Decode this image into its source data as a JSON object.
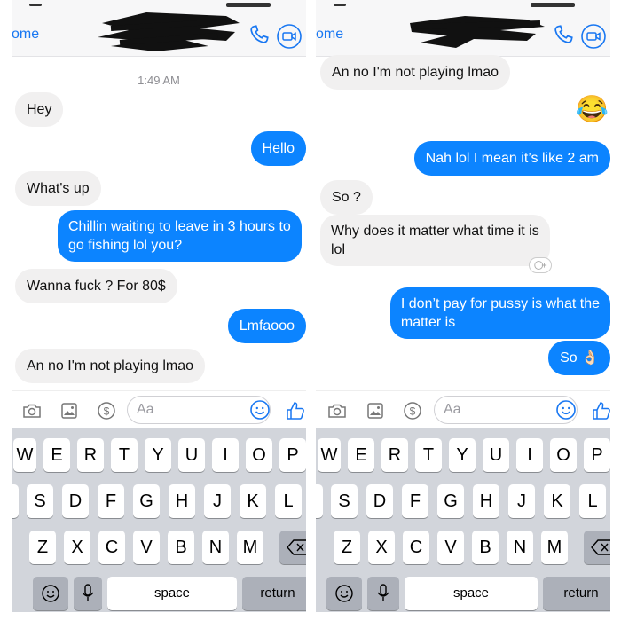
{
  "left": {
    "back_label": "ome",
    "timestamp": "1:49 AM",
    "messages": [
      {
        "dir": "in",
        "text": "Hey"
      },
      {
        "dir": "out",
        "text": "Hello"
      },
      {
        "dir": "in",
        "text": "What's up"
      },
      {
        "dir": "out",
        "text": "Chillin waiting to leave in 3 hours to\ngo fishing lol you?"
      },
      {
        "dir": "in",
        "text": "Wanna fuck ? For 80$"
      },
      {
        "dir": "out",
        "text": "Lmfaooo"
      },
      {
        "dir": "in",
        "text": "An no I'm not playing lmao"
      }
    ],
    "composer_placeholder": "Aa"
  },
  "right": {
    "back_label": "ome",
    "messages": [
      {
        "dir": "in",
        "text": "An no I'm not playing lmao"
      },
      {
        "dir": "emoji",
        "text": "😂"
      },
      {
        "dir": "out",
        "text": "Nah lol I mean it’s like 2 am"
      },
      {
        "dir": "in",
        "text": "So ?"
      },
      {
        "dir": "in",
        "text": "Why does it matter what time it is\nlol"
      },
      {
        "dir": "out",
        "text": "I don’t pay for pussy is what the\nmatter is"
      },
      {
        "dir": "out",
        "text": "So 👌🏻"
      }
    ],
    "composer_placeholder": "Aa"
  },
  "keyboard": {
    "row1": [
      "W",
      "E",
      "R",
      "T",
      "Y",
      "U",
      "I",
      "O",
      "P"
    ],
    "row2": [
      "A",
      "S",
      "D",
      "F",
      "G",
      "H",
      "J",
      "K",
      "L"
    ],
    "row3": [
      "Z",
      "X",
      "C",
      "V",
      "B",
      "N",
      "M"
    ],
    "space_label": "space",
    "return_label": "return"
  },
  "colors": {
    "accent": "#0c84ff",
    "incoming_bubble": "#f1f0f0",
    "keyboard_bg": "#d2d5db"
  },
  "icons": [
    "phone-icon",
    "video-call-icon",
    "camera-icon",
    "image-icon",
    "payment-icon",
    "emoji-icon",
    "like-icon",
    "backspace-icon",
    "emoji-keyboard-icon",
    "microphone-icon",
    "add-reaction-icon"
  ]
}
